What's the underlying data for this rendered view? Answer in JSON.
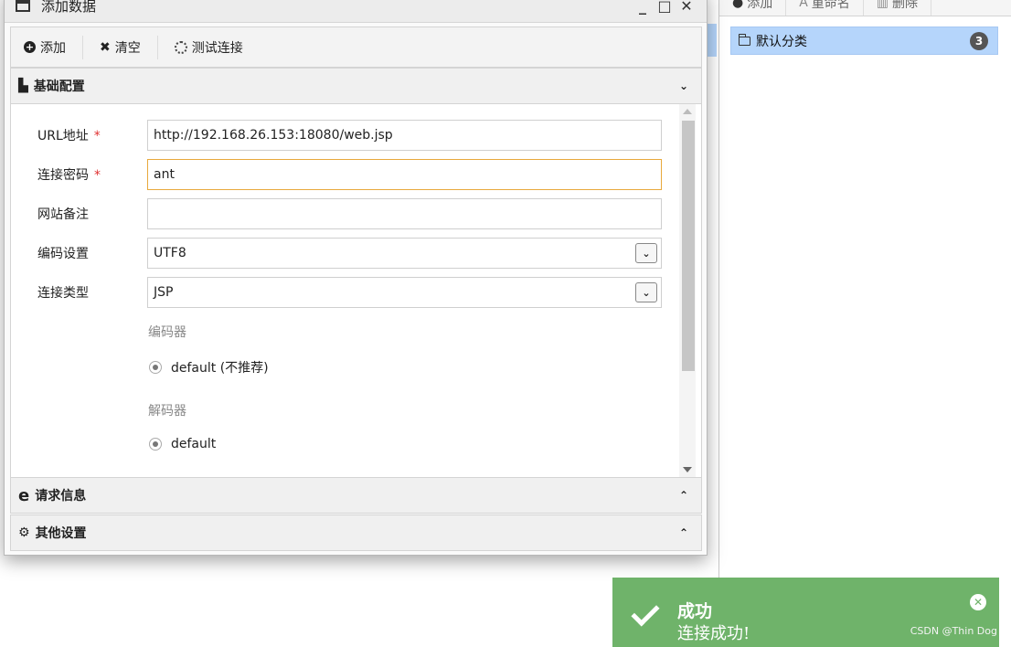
{
  "dialog": {
    "title": "添加数据",
    "controls": {
      "minimize": "_",
      "maximize": "□",
      "close": "✕"
    },
    "toolbar": {
      "add_label": "添加",
      "clear_label": "清空",
      "test_label": "测试连接"
    },
    "basic_section": {
      "title": "基础配置",
      "url_label": "URL地址",
      "url_value": "http://192.168.26.153:18080/web.jsp",
      "password_label": "连接密码",
      "password_value": "ant",
      "note_label": "网站备注",
      "note_value": "",
      "encoding_label": "编码设置",
      "encoding_value": "UTF8",
      "type_label": "连接类型",
      "type_value": "JSP",
      "encoder_heading": "编码器",
      "encoder_option": "default (不推荐)",
      "decoder_heading": "解码器",
      "decoder_option": "default",
      "required_mark": "*"
    },
    "request_section": {
      "title": "请求信息"
    },
    "other_section": {
      "title": "其他设置"
    }
  },
  "right_panel": {
    "toolbar": {
      "add_label": "添加",
      "rename_label": "重命名",
      "delete_label": "删除"
    },
    "category": {
      "label": "默认分类",
      "count": "3"
    }
  },
  "toast": {
    "title": "成功",
    "message": "连接成功!",
    "watermark": "CSDN @Thin Dog"
  }
}
